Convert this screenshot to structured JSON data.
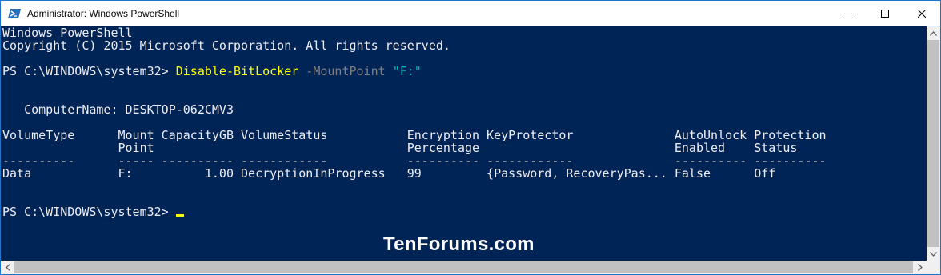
{
  "window": {
    "title": "Administrator: Windows PowerShell"
  },
  "console": {
    "banner1": "Windows PowerShell",
    "banner2": "Copyright (C) 2015 Microsoft Corporation. All rights reserved.",
    "prompt": "PS C:\\WINDOWS\\system32> ",
    "command": "Disable-BitLocker",
    "param": " -MountPoint ",
    "arg": "\"F:\"",
    "computer_line": "   ComputerName: DESKTOP-062CMV3",
    "header1": "VolumeType      Mount CapacityGB VolumeStatus           Encryption KeyProtector              AutoUnlock Protection",
    "header2": "                Point                                   Percentage                           Enabled    Status",
    "separator": "----------      ----- ---------- ------------           ---------- ------------              ---------- ----------",
    "row1": "Data            F:          1.00 DecryptionInProgress   99         {Password, RecoveryPas... False      Off",
    "prompt2": "PS C:\\WINDOWS\\system32> "
  },
  "watermark": "TenForums.com",
  "colors": {
    "background": "#012456",
    "command": "#ffff00",
    "parameter": "#808080",
    "string": "#00b0b8",
    "text": "#eeedf0"
  },
  "icons": {
    "app": "powershell-icon",
    "minimize": "minimize-icon",
    "maximize": "maximize-icon",
    "close": "close-icon"
  }
}
